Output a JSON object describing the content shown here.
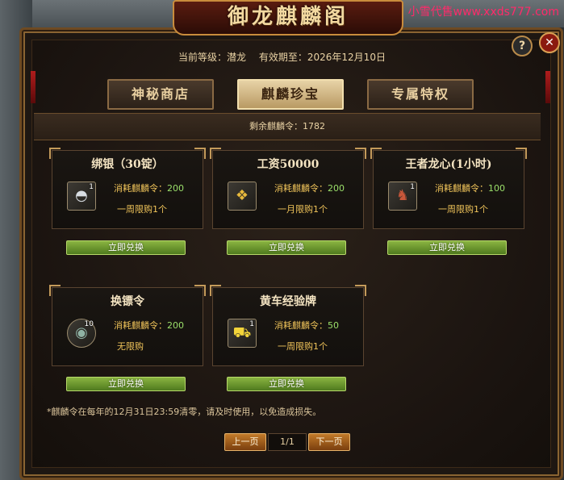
{
  "window": {
    "title": "御龙麒麟阁",
    "help_label": "?",
    "close_label": "✕"
  },
  "watermark": "小雪代售www.xxds777.com",
  "info": {
    "level_text": "当前等级：潜龙",
    "expiry_text": "有效期至：2026年12月10日"
  },
  "tabs": [
    {
      "label": "神秘商店",
      "active": false
    },
    {
      "label": "麒麟珍宝",
      "active": true
    },
    {
      "label": "专属特权",
      "active": false
    }
  ],
  "remaining": "剩余麒麟令：1782",
  "items": [
    {
      "title": "绑银（30锭）",
      "icon": "silver-ingot-icon",
      "qty": "1",
      "cost_label": "消耗麒麟令：",
      "cost_value": "200",
      "limit": "一周限购1个",
      "button": "立即兑换"
    },
    {
      "title": "工资50000",
      "icon": "gold-scroll-icon",
      "qty": "",
      "cost_label": "消耗麒麟令：",
      "cost_value": "200",
      "limit": "一月限购1个",
      "button": "立即兑换"
    },
    {
      "title": "王者龙心(1小时)",
      "icon": "dragon-heart-icon",
      "qty": "1",
      "cost_label": "消耗麒麟令：",
      "cost_value": "100",
      "limit": "一周限购1个",
      "button": "立即兑换"
    },
    {
      "title": "换镖令",
      "icon": "escort-token-icon",
      "qty": "10",
      "cost_label": "消耗麒麟令：",
      "cost_value": "200",
      "limit": "无限购",
      "button": "立即兑换"
    },
    {
      "title": "黄车经验牌",
      "icon": "yellow-cart-icon",
      "qty": "1",
      "cost_label": "消耗麒麟令：",
      "cost_value": "50",
      "limit": "一周限购1个",
      "button": "立即兑换"
    }
  ],
  "notice": "*麒麟令在每年的12月31日23:59清零，请及时使用，以免造成损失。",
  "pager": {
    "prev": "上一页",
    "current": "1/1",
    "next": "下一页"
  }
}
